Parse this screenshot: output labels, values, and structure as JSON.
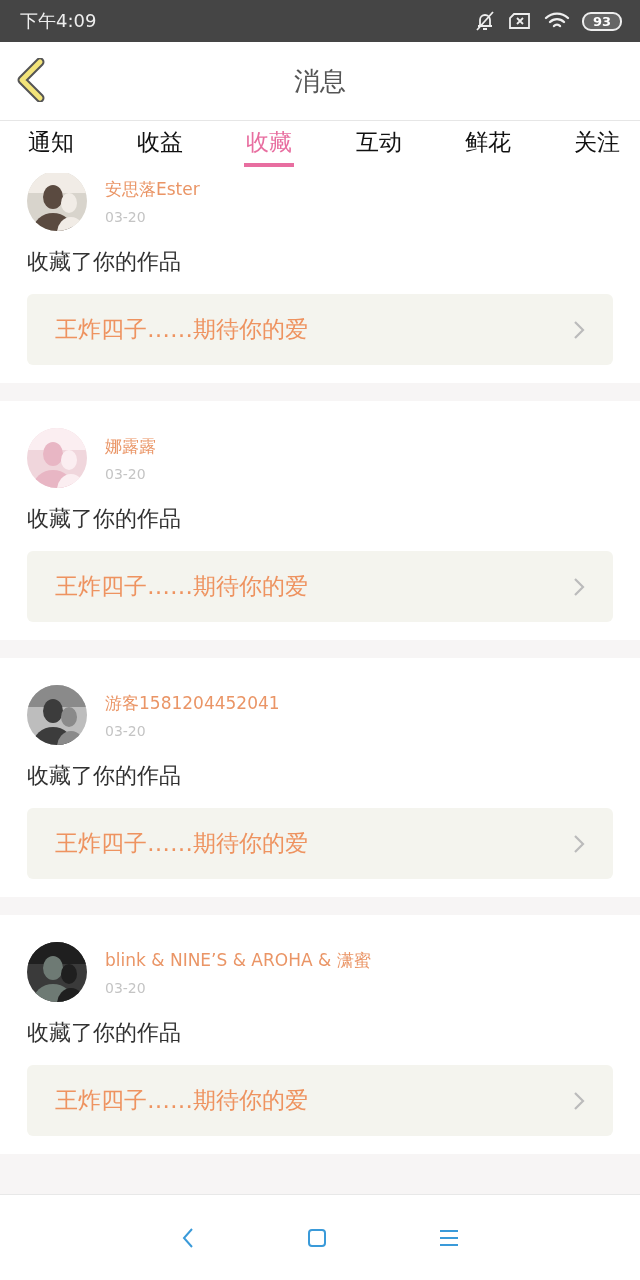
{
  "status_bar": {
    "time": "下午4:09",
    "battery": "93"
  },
  "header": {
    "title": "消息"
  },
  "tabs": [
    {
      "label": "通知",
      "selected": false
    },
    {
      "label": "收益",
      "selected": false
    },
    {
      "label": "收藏",
      "selected": true
    },
    {
      "label": "互动",
      "selected": false
    },
    {
      "label": "鲜花",
      "selected": false
    },
    {
      "label": "关注",
      "selected": false
    }
  ],
  "notifications": [
    {
      "name": "安思落Ester",
      "date": "03-20",
      "action": "收藏了你的作品",
      "work": "王炸四子……期待你的爱"
    },
    {
      "name": "娜露露",
      "date": "03-20",
      "action": "收藏了你的作品",
      "work": "王炸四子……期待你的爱"
    },
    {
      "name": "游客1581204452041",
      "date": "03-20",
      "action": "收藏了你的作品",
      "work": "王炸四子……期待你的爱"
    },
    {
      "name": "blink & NINE’S & AROHA & 潇蜜",
      "date": "03-20",
      "action": "收藏了你的作品",
      "work": "王炸四子……期待你的爱"
    }
  ]
}
